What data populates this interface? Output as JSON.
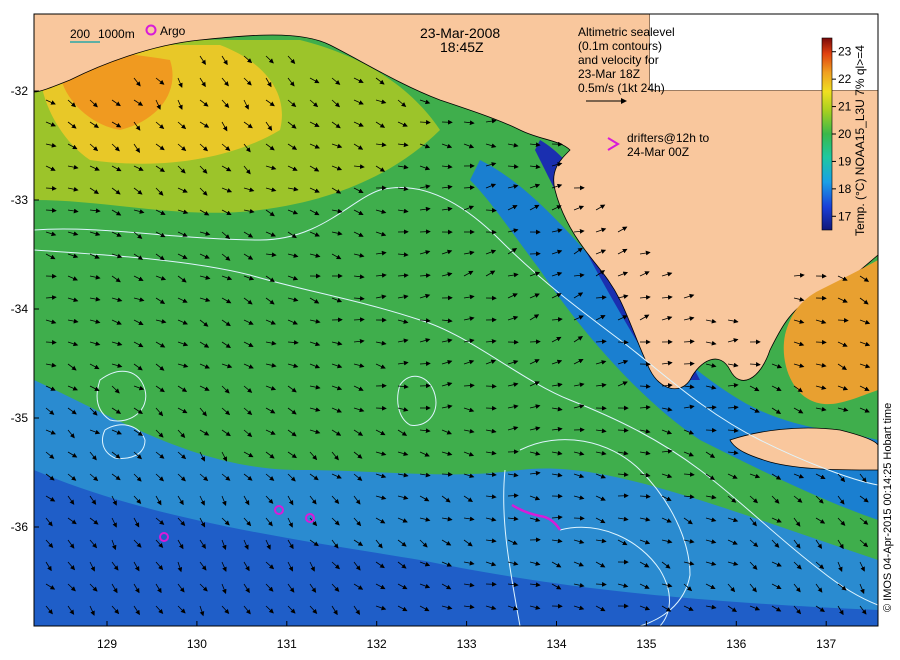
{
  "title": {
    "date": "23-Mar-2008",
    "time": "18:45Z"
  },
  "bathymetry_legend": {
    "label_200": "200",
    "label_1000": "1000m"
  },
  "argo_legend": "Argo",
  "sealevel_note": {
    "line1": "Altimetric sealevel",
    "line2": "(0.1m contours)",
    "line3": "and velocity for",
    "line4": "23-Mar 18Z",
    "line5": "0.5m/s (1kt 24h)"
  },
  "drifter_note": {
    "line1": "drifters@12h to",
    "line2": "24-Mar 00Z"
  },
  "colorbar": {
    "label": "Temp. (°C) NOAA15_L3U 7% ql>=4",
    "ticks": [
      "17",
      "18",
      "19",
      "20",
      "21",
      "22",
      "23"
    ],
    "min": 16.5,
    "max": 23.5
  },
  "axes": {
    "x_ticks": [
      "129",
      "130",
      "131",
      "132",
      "133",
      "134",
      "135",
      "136",
      "137"
    ],
    "y_ticks": [
      "-32",
      "-33",
      "-34",
      "-35",
      "-36"
    ]
  },
  "credit": "© IMOS 04-Apr-2015 00:14:25 Hobart time",
  "colors": {
    "land": "#f9c79d",
    "sst_cold": "#1a3fb8",
    "sst_mid": "#37b34a",
    "sst_warm": "#f0a020",
    "drifter": "#d81bd8",
    "contour": "#dff5ff"
  }
}
